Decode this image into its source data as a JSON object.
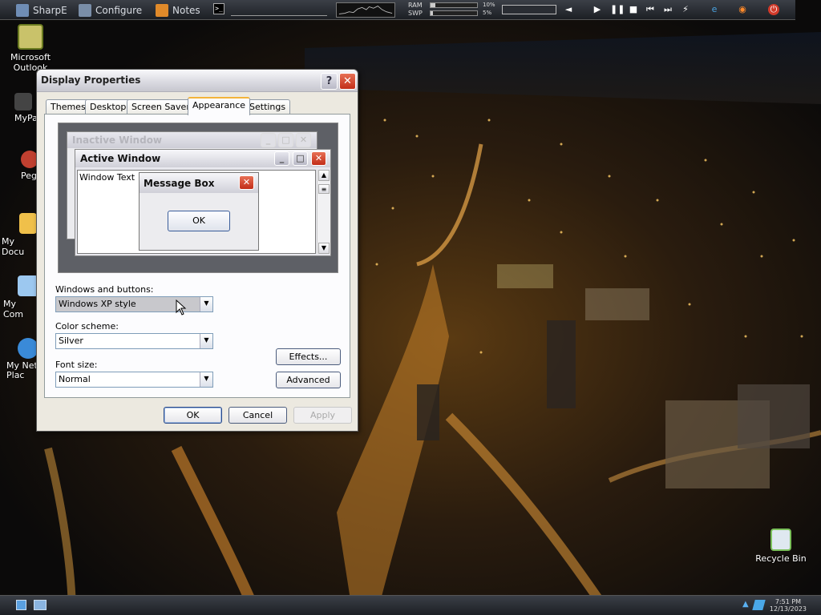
{
  "topbar": {
    "items": [
      {
        "label": "SharpE",
        "icon": "sharpe-icon"
      },
      {
        "label": "Configure",
        "icon": "configure-icon"
      },
      {
        "label": "Notes",
        "icon": "notes-icon"
      }
    ],
    "ram_label": "RAM",
    "swp_label": "SWP",
    "ram_pct": "10%",
    "swp_pct": "5%",
    "ram_value": 0.1,
    "swp_value": 0.05,
    "media_buttons": [
      "play-icon",
      "pause-icon",
      "stop-icon",
      "prev-icon",
      "next-icon"
    ]
  },
  "desktop": {
    "icons": [
      {
        "label": "Microsoft Outlook"
      },
      {
        "label": "MyPa"
      },
      {
        "label": "Peg"
      },
      {
        "label": "My Docu"
      },
      {
        "label": "My Com"
      },
      {
        "label": "My Net Plac"
      },
      {
        "label": "Recycle Bin"
      }
    ]
  },
  "dialog": {
    "title": "Display Properties",
    "help_glyph": "?",
    "close_glyph": "✕",
    "tabs": [
      "Themes",
      "Desktop",
      "Screen Saver",
      "Appearance",
      "Settings"
    ],
    "active_tab": "Appearance",
    "preview": {
      "inactive_title": "Inactive Window",
      "active_title": "Active Window",
      "window_text": "Window Text",
      "message_title": "Message Box",
      "message_ok": "OK"
    },
    "windows_buttons_label": "Windows and buttons:",
    "windows_buttons_value": "Windows XP style",
    "color_scheme_label": "Color scheme:",
    "color_scheme_value": "Silver",
    "font_size_label": "Font size:",
    "font_size_value": "Normal",
    "effects_button": "Effects...",
    "advanced_button": "Advanced",
    "ok_button": "OK",
    "cancel_button": "Cancel",
    "apply_button": "Apply"
  },
  "taskbar": {
    "time": "7:51 PM",
    "date": "12/13/2023"
  },
  "colors": {
    "tab_highlight": "#f3b43a",
    "close_red": "#c22d18",
    "dialog_bg": "#ece9e0"
  }
}
